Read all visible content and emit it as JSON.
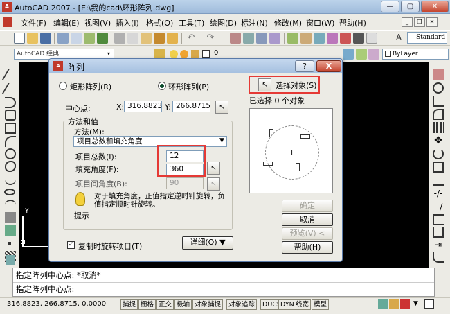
{
  "app": {
    "title": "AutoCAD 2007 - [E:\\我的cad\\环形阵列.dwg]",
    "icon_text": "A"
  },
  "window_controls": {
    "min": "—",
    "max": "▢",
    "close": "✕"
  },
  "menu": [
    "文件(F)",
    "编辑(E)",
    "视图(V)",
    "插入(I)",
    "格式(O)",
    "工具(T)",
    "绘图(D)",
    "标注(N)",
    "修改(M)",
    "窗口(W)",
    "帮助(H)"
  ],
  "toolbar": {
    "text_style": "Standard",
    "workspace": "AutoCAD 经典",
    "layer": "0",
    "linetype": "ByLayer"
  },
  "colors": {
    "accent": "#316ac5",
    "highlight": "#e53935",
    "canvas": "#000000"
  },
  "dialog": {
    "title": "阵列",
    "help_btn": "?",
    "close_btn": "X",
    "rect_array_label": "矩形阵列(R)",
    "polar_array_label": "环形阵列(P)",
    "select_objects_label": "选择对象(S)",
    "selected_count_label": "已选择 0 个对象",
    "center_point_label": "中心点:",
    "x_label": "X:",
    "x_value": "316.8823",
    "y_label": "Y:",
    "y_value": "266.8715",
    "method_group_label": "方法和值",
    "method_label": "方法(M):",
    "method_value": "项目总数和填充角度",
    "total_items_label": "项目总数(I):",
    "total_items_value": "12",
    "fill_angle_label": "填充角度(F):",
    "fill_angle_value": "360",
    "item_angle_label": "项目间角度(B):",
    "item_angle_value": "90",
    "tip_text": "对于填充角度，正值指定逆时针旋转，负值指定顺时针旋转。",
    "tip_label": "提示",
    "rotate_items_label": "复制时旋转项目(T)",
    "details_btn": "详细(O)",
    "ok_btn": "确定",
    "cancel_btn": "取消",
    "preview_btn": "预览(V) <",
    "help_btn2": "帮助(H)"
  },
  "command": {
    "line1": "指定阵列中心点: *取消*",
    "line2": "指定阵列中心点:"
  },
  "status": {
    "coords": "316.8823, 266.8715, 0.0000",
    "toggles": [
      "捕捉",
      "栅格",
      "正交",
      "极轴",
      "对象捕捉",
      "对象追踪",
      "DUCS",
      "DYN",
      "线宽",
      "模型"
    ]
  }
}
